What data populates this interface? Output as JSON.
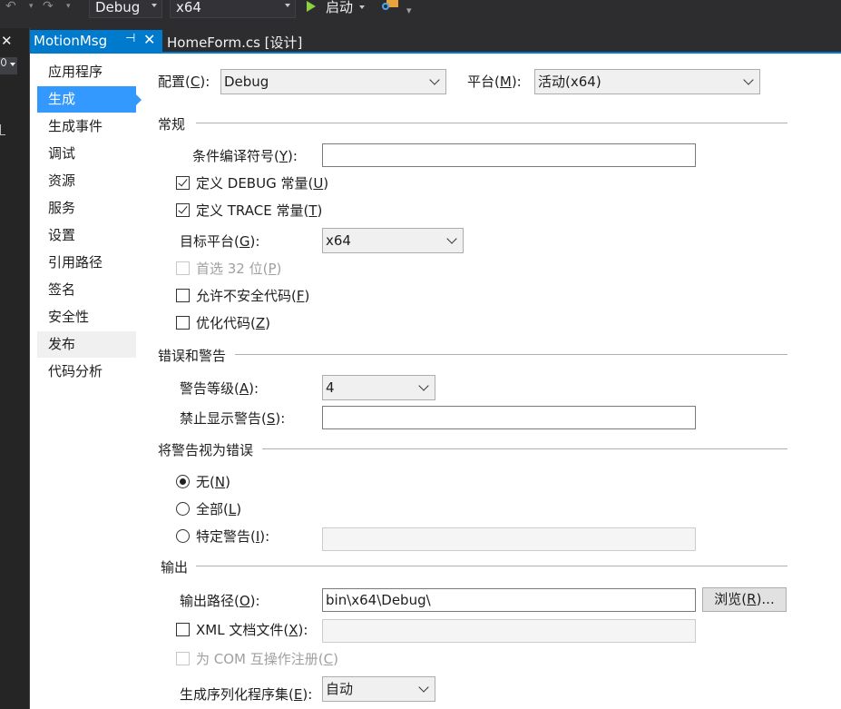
{
  "toolbar": {
    "config_combo": "Debug",
    "platform_combo": "x64",
    "start_label": "启动"
  },
  "tabs": [
    {
      "label": "MotionMsg",
      "pin": "⊣",
      "close": "✕"
    },
    {
      "label": "HomeForm.cs [设计]"
    }
  ],
  "nav": {
    "items": [
      "应用程序",
      "生成",
      "生成事件",
      "调试",
      "资源",
      "服务",
      "设置",
      "引用路径",
      "签名",
      "安全性",
      "发布",
      "代码分析"
    ],
    "active_index": 1,
    "hover_index": 10
  },
  "top": {
    "config_label": "配置(",
    "config_key": "C",
    "config_label_end": "):",
    "config_value": "Debug",
    "platform_label": "平台(",
    "platform_key": "M",
    "platform_label_end": "):",
    "platform_value": "活动(x64)"
  },
  "general": {
    "title": "常规",
    "conditional_label": "条件编译符号(",
    "conditional_key": "Y",
    "conditional_end": "):",
    "conditional_value": "",
    "debug_label": "定义 DEBUG 常量(",
    "debug_key": "U",
    "debug_end": ")",
    "debug_checked": true,
    "trace_label": "定义 TRACE 常量(",
    "trace_key": "T",
    "trace_end": ")",
    "trace_checked": true,
    "target_label": "目标平台(",
    "target_key": "G",
    "target_end": "):",
    "target_value": "x64",
    "prefer32_label": "首选 32 位(",
    "prefer32_key": "P",
    "prefer32_end": ")",
    "unsafe_label": "允许不安全代码(",
    "unsafe_key": "F",
    "unsafe_end": ")",
    "optimize_label": "优化代码(",
    "optimize_key": "Z",
    "optimize_end": ")"
  },
  "errors": {
    "title": "错误和警告",
    "warn_level_label": "警告等级(",
    "warn_level_key": "A",
    "warn_level_end": "):",
    "warn_level_value": "4",
    "suppress_label": "禁止显示警告(",
    "suppress_key": "S",
    "suppress_end": "):",
    "suppress_value": ""
  },
  "treat": {
    "title": "将警告视为错误",
    "none_label": "无(",
    "none_key": "N",
    "none_end": ")",
    "all_label": "全部(",
    "all_key": "L",
    "all_end": ")",
    "specific_label": "特定警告(",
    "specific_key": "I",
    "specific_end": "):",
    "selected": "none"
  },
  "output": {
    "title": "输出",
    "path_label": "输出路径(",
    "path_key": "O",
    "path_end": "):",
    "path_value": "bin\\x64\\Debug\\",
    "browse_label": "浏览(",
    "browse_key": "R",
    "browse_end": ")...",
    "xml_label": "XML 文档文件(",
    "xml_key": "X",
    "xml_end": "):",
    "com_label": "为 COM 互操作注册(",
    "com_key": "C",
    "com_end": ")",
    "serial_label": "生成序列化程序集(",
    "serial_key": "E",
    "serial_end": "):",
    "serial_value": "自动"
  }
}
